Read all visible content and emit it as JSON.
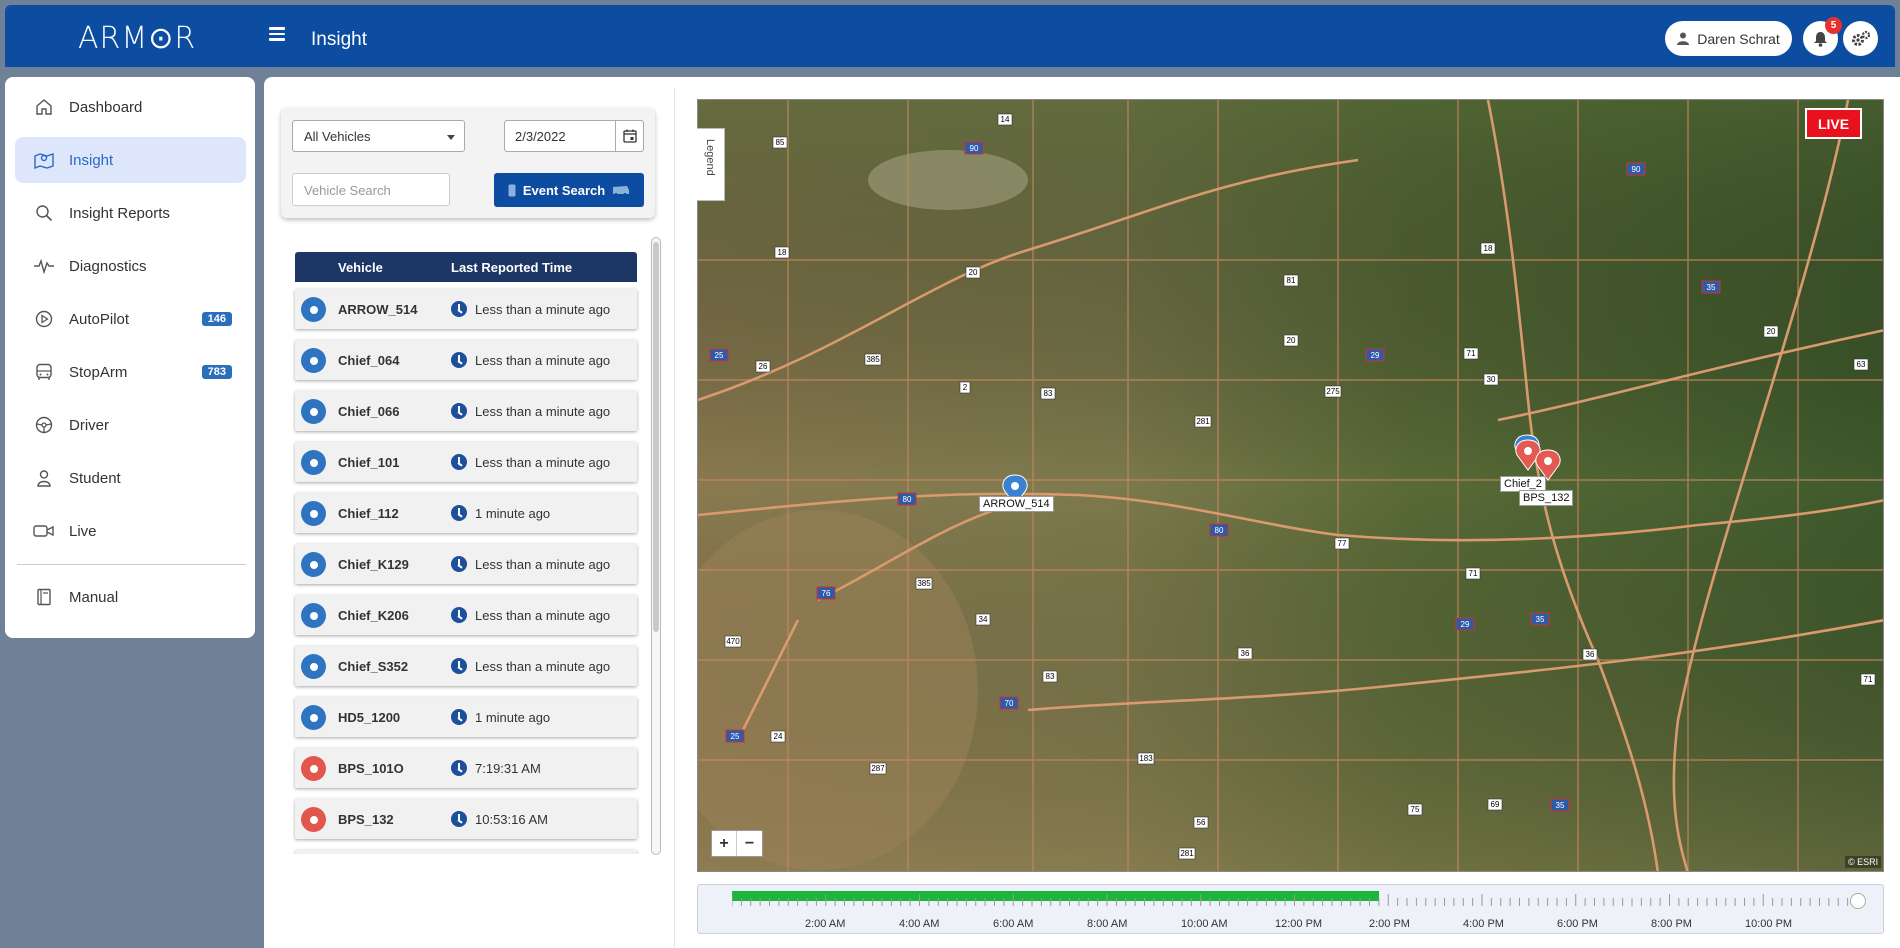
{
  "header": {
    "logo": "ARM⊙R",
    "title": "Insight",
    "user_name": "Daren Schrat",
    "notification_count": "5"
  },
  "sidebar": {
    "items": [
      {
        "label": "Dashboard",
        "icon": "home-icon"
      },
      {
        "label": "Insight",
        "icon": "map-icon",
        "active": true
      },
      {
        "label": "Insight Reports",
        "icon": "search-icon"
      },
      {
        "label": "Diagnostics",
        "icon": "pulse-icon"
      },
      {
        "label": "AutoPilot",
        "icon": "play-circle-icon",
        "badge": "146"
      },
      {
        "label": "StopArm",
        "icon": "bus-icon",
        "badge": "783"
      },
      {
        "label": "Driver",
        "icon": "steering-wheel-icon"
      },
      {
        "label": "Student",
        "icon": "student-icon"
      },
      {
        "label": "Live",
        "icon": "video-camera-icon"
      },
      {
        "label": "Manual",
        "icon": "book-icon"
      }
    ]
  },
  "filters": {
    "vehicle_select": "All Vehicles",
    "date": "2/3/2022",
    "search_placeholder": "Vehicle Search",
    "event_search_label": "Event Search"
  },
  "vehicle_list": {
    "headers": [
      "Vehicle",
      "Last Reported Time"
    ],
    "rows": [
      {
        "vehicle": "ARROW_514",
        "time": "Less than a minute ago",
        "status": "blue"
      },
      {
        "vehicle": "Chief_064",
        "time": "Less than a minute ago",
        "status": "blue"
      },
      {
        "vehicle": "Chief_066",
        "time": "Less than a minute ago",
        "status": "blue"
      },
      {
        "vehicle": "Chief_101",
        "time": "Less than a minute ago",
        "status": "blue"
      },
      {
        "vehicle": "Chief_112",
        "time": "1 minute ago",
        "status": "blue"
      },
      {
        "vehicle": "Chief_K129",
        "time": "Less than a minute ago",
        "status": "blue"
      },
      {
        "vehicle": "Chief_K206",
        "time": "Less than a minute ago",
        "status": "blue"
      },
      {
        "vehicle": "Chief_S352",
        "time": "Less than a minute ago",
        "status": "blue"
      },
      {
        "vehicle": "HD5_1200",
        "time": "1 minute ago",
        "status": "blue"
      },
      {
        "vehicle": "BPS_101O",
        "time": "7:19:31 AM",
        "status": "red"
      },
      {
        "vehicle": "BPS_132",
        "time": "10:53:16 AM",
        "status": "red"
      }
    ]
  },
  "map": {
    "live_label": "LIVE",
    "legend_label": "Legend",
    "attribution": "© ESRI",
    "zoom_in": "+",
    "zoom_out": "−",
    "pin_labels": [
      "ARROW_514",
      "Chief_2",
      "BPS_132"
    ],
    "highway_shields": [
      "14",
      "85",
      "90",
      "90",
      "18",
      "20",
      "81",
      "18",
      "35",
      "25",
      "26",
      "385",
      "2",
      "83",
      "20",
      "29",
      "71",
      "275",
      "30",
      "63",
      "20",
      "281",
      "80",
      "80",
      "77",
      "71",
      "76",
      "385",
      "34",
      "470",
      "25",
      "24",
      "287",
      "83",
      "70",
      "36",
      "183",
      "56",
      "281",
      "36",
      "29",
      "35",
      "75",
      "69",
      "35",
      "71"
    ]
  },
  "timeline": {
    "labels": [
      "2:00 AM",
      "4:00 AM",
      "6:00 AM",
      "8:00 AM",
      "10:00 AM",
      "12:00 PM",
      "2:00 PM",
      "4:00 PM",
      "6:00 PM",
      "8:00 PM",
      "10:00 PM"
    ],
    "progress": 0.575
  },
  "colors": {
    "header_bg": "#0d4da1",
    "accent_badge": "#2a6fba",
    "live_red": "#e8111d",
    "timeline_fill": "#1db63c"
  }
}
